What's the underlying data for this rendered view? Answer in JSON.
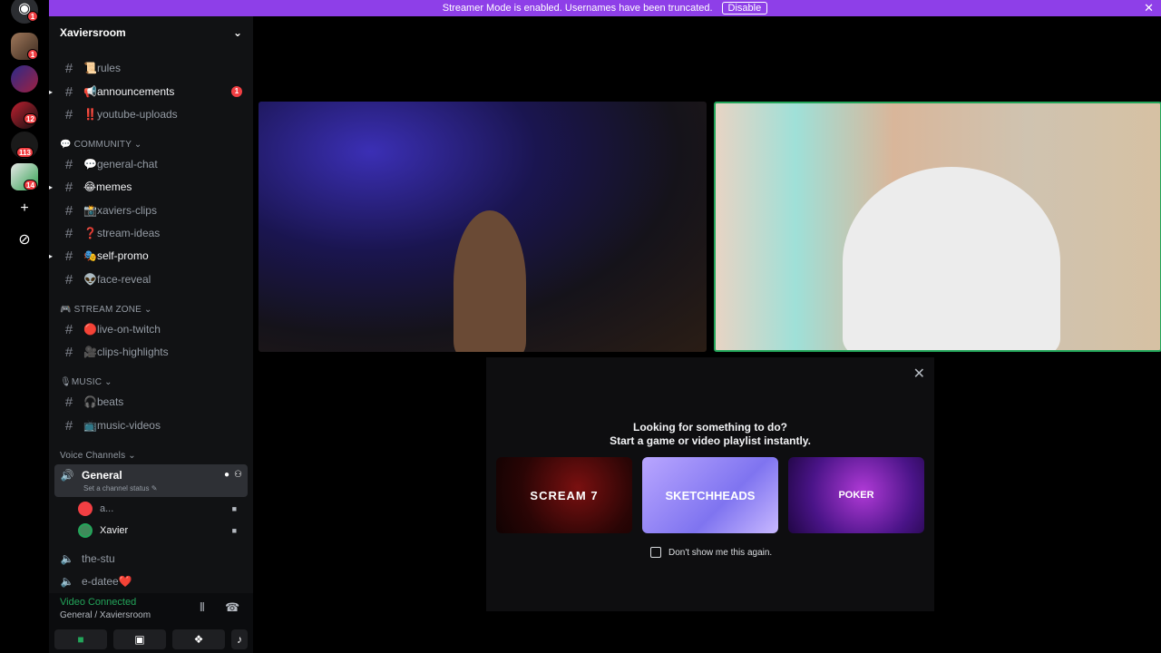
{
  "banner": {
    "text": "Streamer Mode is enabled. Usernames have been truncated.",
    "button": "Disable",
    "close": "✕"
  },
  "rail": {
    "badges": [
      "1",
      "1",
      "12",
      "113",
      "14"
    ]
  },
  "server": {
    "name": "Xaviersroom",
    "chevron": "⌄"
  },
  "channels": {
    "top": [
      {
        "name": "📜rules",
        "unread": false
      },
      {
        "name": "📢announcements",
        "unread": true,
        "count": "1"
      },
      {
        "name": "‼️youtube-uploads",
        "unread": false
      }
    ],
    "community_label": "💬 COMMUNITY",
    "community": [
      {
        "name": "💬general-chat",
        "unread": false
      },
      {
        "name": "😂memes",
        "unread": true
      },
      {
        "name": "📸xaviers-clips",
        "unread": false
      },
      {
        "name": "❓stream-ideas",
        "unread": false
      },
      {
        "name": "🎭self-promo",
        "unread": true
      },
      {
        "name": "👽face-reveal",
        "unread": false
      }
    ],
    "stream_label": "🎮 STREAM ZONE",
    "stream": [
      {
        "name": "🔴live-on-twitch"
      },
      {
        "name": "🎥clips-highlights"
      }
    ],
    "music_label": "🎙MUSIC",
    "music": [
      {
        "name": "🎧beats"
      },
      {
        "name": "📺music-videos"
      }
    ],
    "voice_label": "Voice Channels",
    "voice": {
      "active": {
        "name": "General",
        "status": "Set a channel status ✎"
      },
      "users": [
        {
          "name": "a...",
          "color": "#f23f43"
        },
        {
          "name": "Xavier",
          "color": "#3f8a5a"
        }
      ],
      "others": [
        {
          "name": "the-stu"
        },
        {
          "name": "e-datee❤️"
        }
      ]
    }
  },
  "panel": {
    "title": "Video Connected",
    "subtitle": "General / Xaviersroom"
  },
  "popup": {
    "line1": "Looking for something to do?",
    "line2": "Start a game or video playlist instantly.",
    "cards": [
      "SCREAM 7",
      "SKETCHHEADS",
      "POKER"
    ],
    "checkbox_label": "Don't show me this again.",
    "close": "✕"
  },
  "colors": {
    "banner": "#8e3fe8",
    "connected": "#23a55a",
    "badge": "#f23f43"
  }
}
